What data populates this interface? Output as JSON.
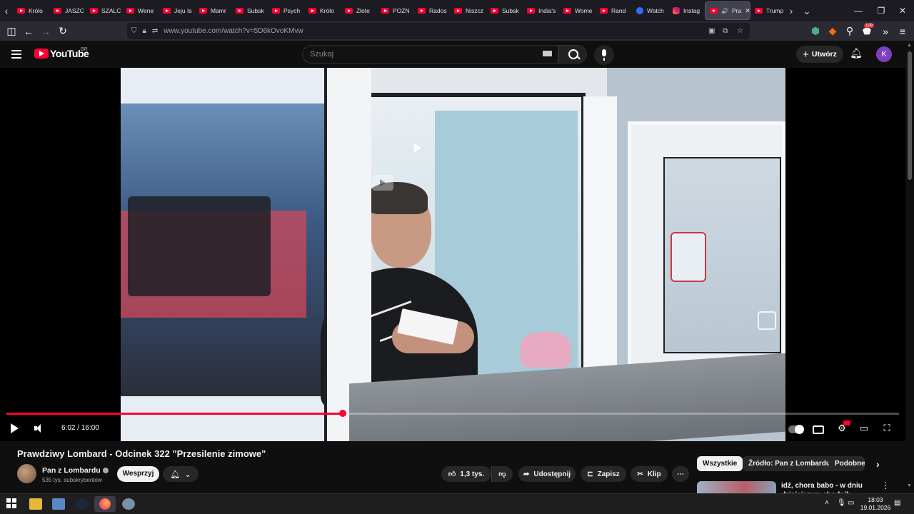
{
  "browser": {
    "tabs": [
      {
        "label": "Królo",
        "fav": "yt"
      },
      {
        "label": "JASZC",
        "fav": "yt"
      },
      {
        "label": "SZALC",
        "fav": "yt"
      },
      {
        "label": "Wene",
        "fav": "yt"
      },
      {
        "label": "Jeju Is",
        "fav": "yt"
      },
      {
        "label": "Mamr",
        "fav": "yt"
      },
      {
        "label": "Subsk",
        "fav": "yt"
      },
      {
        "label": "Psych",
        "fav": "yt"
      },
      {
        "label": "Królo",
        "fav": "yt"
      },
      {
        "label": "Złote",
        "fav": "yt"
      },
      {
        "label": "POZN",
        "fav": "yt"
      },
      {
        "label": "Rados",
        "fav": "yt"
      },
      {
        "label": "Niszcz",
        "fav": "yt"
      },
      {
        "label": "Subsk",
        "fav": "yt"
      },
      {
        "label": "India's",
        "fav": "yt"
      },
      {
        "label": "Wome",
        "fav": "yt"
      },
      {
        "label": "Rand",
        "fav": "yt"
      },
      {
        "label": "Watch",
        "fav": "g"
      },
      {
        "label": "Instag",
        "fav": "ig"
      }
    ],
    "active_tab_label": "Pra",
    "after_tab_label": "Trump",
    "url": "www.youtube.com/watch?v=5D6kOvoKMvw",
    "ext_badge": "109"
  },
  "youtube": {
    "wordmark": "YouTube",
    "region": "BR",
    "search_placeholder": "Szukaj",
    "create_label": "Utwórz",
    "avatar_letter": "K"
  },
  "player": {
    "time": "6:02 / 16:00",
    "progress_fraction": 0.377
  },
  "video": {
    "title": "Prawdziwy Lombard - Odcinek 322 \"Przesilenie zimowe\"",
    "channel": "Pan z Lombardu",
    "subscribers": "535 tys. subskrybentów",
    "support_label": "Wesprzyj",
    "likes": "1,3 tys.",
    "share_label": "Udostępnij",
    "save_label": "Zapisz",
    "clip_label": "Klip"
  },
  "recommendations": {
    "chips": [
      "Wszystkie",
      "Źródło: Pan z Lombardu",
      "Podobne"
    ],
    "first_title": "idź, chora babo - w dniu dzisiejszym chodnik niesamy"
  },
  "taskbar": {
    "time": "18:03",
    "date": "19.01.2026"
  },
  "colors": {
    "accent": "#ff0033",
    "background": "#0f0f0f"
  }
}
